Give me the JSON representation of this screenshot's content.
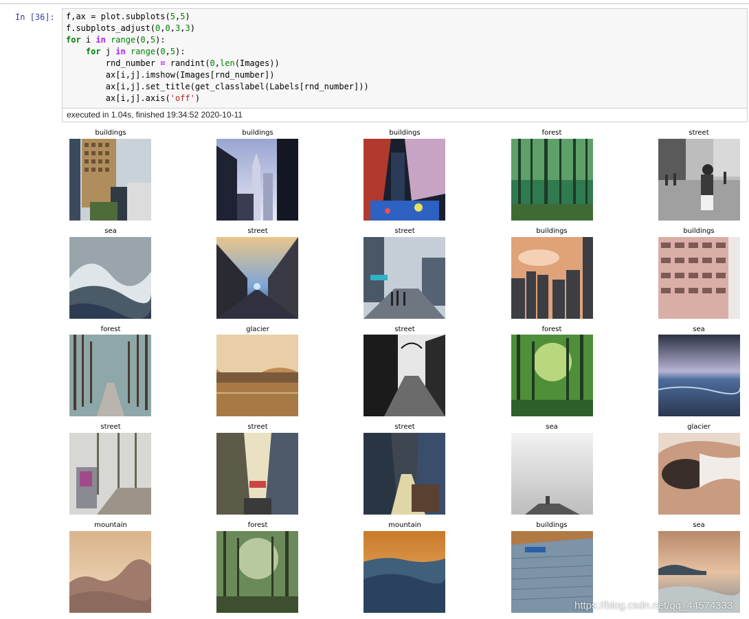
{
  "cell": {
    "prompt": "In  [36]:",
    "execution_status": "executed in 1.04s, finished 19:34:52 2020-10-11"
  },
  "output": {
    "titles": [
      [
        "buildings",
        "buildings",
        "buildings",
        "forest",
        "street"
      ],
      [
        "sea",
        "street",
        "street",
        "buildings",
        "buildings"
      ],
      [
        "forest",
        "glacier",
        "street",
        "forest",
        "sea"
      ],
      [
        "street",
        "street",
        "street",
        "sea",
        "glacier"
      ],
      [
        "mountain",
        "forest",
        "mountain",
        "buildings",
        "sea"
      ]
    ]
  },
  "watermark": "https://blog.csdn.net/qq_44574333",
  "colors": {
    "prompt": "#303f9f",
    "keyword": "#008000",
    "string": "#ba2121",
    "operator": "#aa22ff",
    "code_bg": "#f7f7f7"
  }
}
